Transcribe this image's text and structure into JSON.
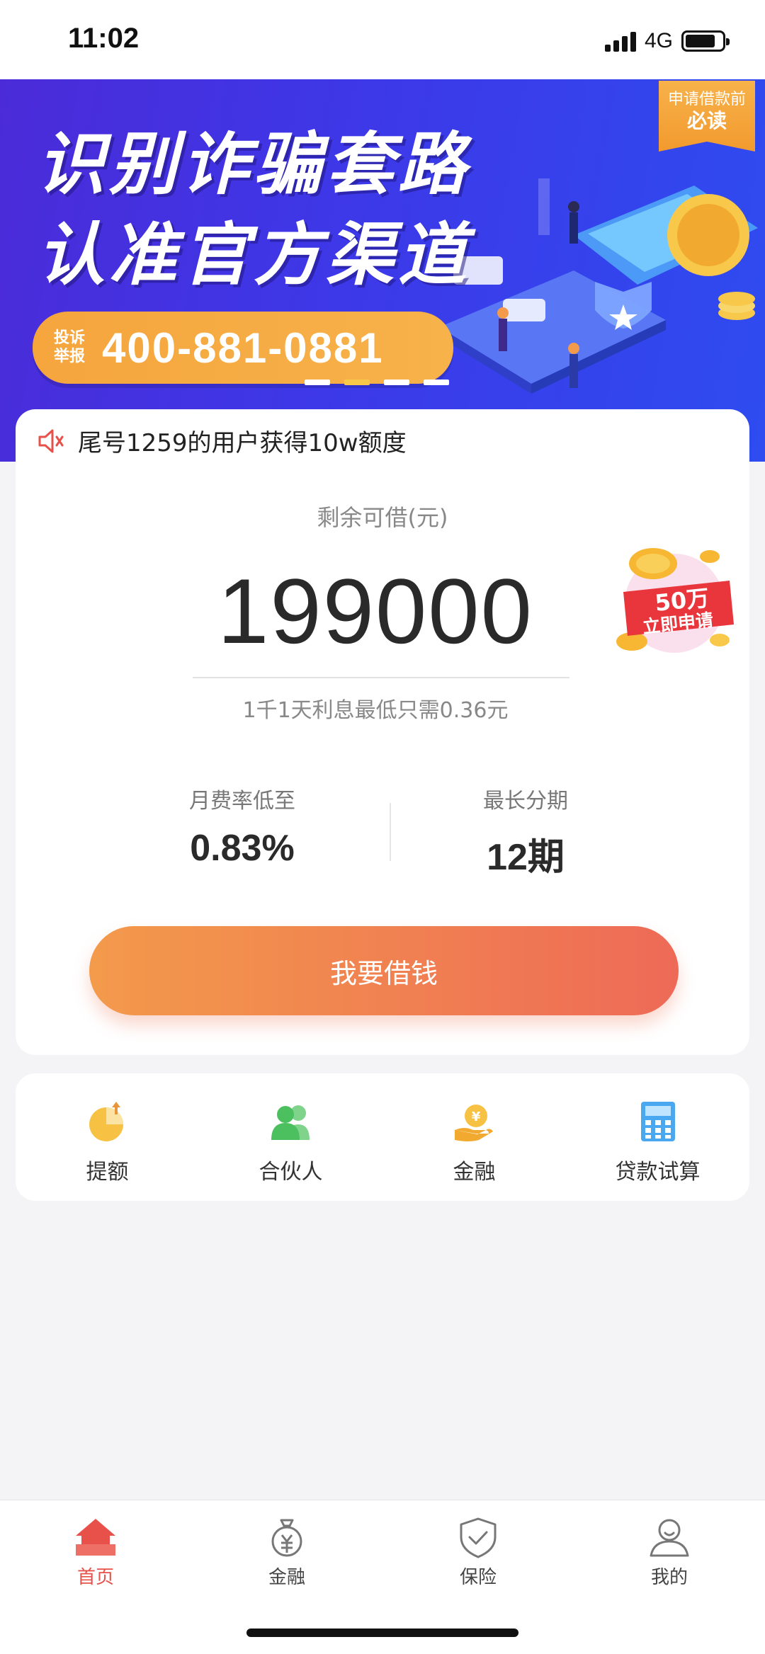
{
  "status_bar": {
    "time": "11:02",
    "network": "4G"
  },
  "banner": {
    "tag_line1": "申请借款前",
    "tag_line2": "必读",
    "headline_line1": "识别诈骗套路",
    "headline_line2": "认准官方渠道",
    "report_label_line1": "投诉",
    "report_label_line2": "举报",
    "hotline": "400-881-0881",
    "slide_count": 4,
    "active_slide": 1
  },
  "loan_card": {
    "notice": "尾号1259的用户获得10w额度",
    "amount_label": "剩余可借(元)",
    "amount": "199000",
    "interest_note": "1千1天利息最低只需0.36元",
    "badge_line1": "50万",
    "badge_line2": "立即申请",
    "stats": [
      {
        "label": "月费率低至",
        "value": "0.83%"
      },
      {
        "label": "最长分期",
        "value": "12期"
      }
    ],
    "cta_label": "我要借钱"
  },
  "quick_actions": [
    {
      "label": "提额",
      "icon": "pie-chart-icon"
    },
    {
      "label": "合伙人",
      "icon": "users-icon"
    },
    {
      "label": "金融",
      "icon": "coin-hand-icon"
    },
    {
      "label": "贷款试算",
      "icon": "calculator-icon"
    }
  ],
  "tab_bar": [
    {
      "label": "首页",
      "icon": "home-icon",
      "active": true
    },
    {
      "label": "金融",
      "icon": "money-bag-icon",
      "active": false
    },
    {
      "label": "保险",
      "icon": "shield-check-icon",
      "active": false
    },
    {
      "label": "我的",
      "icon": "user-icon",
      "active": false
    }
  ],
  "colors": {
    "accent_red": "#e8504a",
    "cta_gradient_start": "#f39a4b",
    "cta_gradient_end": "#ee6a57",
    "banner_blue": "#3d38e8",
    "banner_orange": "#f6a53d"
  }
}
